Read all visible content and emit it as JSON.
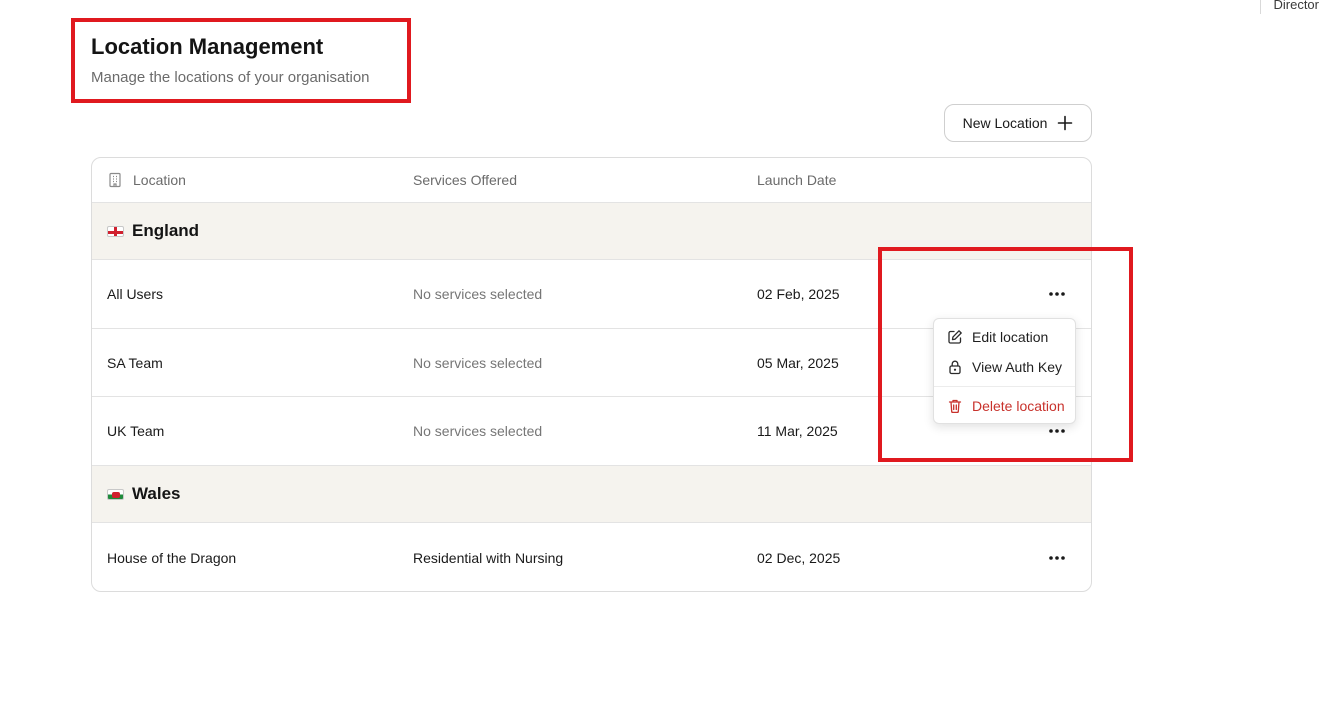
{
  "header": {
    "user_role": "Director",
    "title": "Location Management",
    "subtitle": "Manage the locations of your organisation"
  },
  "toolbar": {
    "new_location_label": "New Location"
  },
  "table": {
    "columns": {
      "location": "Location",
      "services": "Services Offered",
      "launch_date": "Launch Date"
    },
    "groups": [
      {
        "name": "England",
        "flag": "england-flag-icon",
        "rows": [
          {
            "location": "All Users",
            "services": "No services selected",
            "launch_date": "02 Feb, 2025"
          },
          {
            "location": "SA Team",
            "services": "No services selected",
            "launch_date": "05 Mar, 2025"
          },
          {
            "location": "UK Team",
            "services": "No services selected",
            "launch_date": "11 Mar, 2025"
          }
        ]
      },
      {
        "name": "Wales",
        "flag": "wales-flag-icon",
        "rows": [
          {
            "location": "House of the Dragon",
            "services": "Residential with Nursing",
            "launch_date": "02 Dec, 2025"
          }
        ]
      }
    ]
  },
  "row_menu": {
    "items": [
      {
        "label": "Edit location",
        "icon": "edit-icon"
      },
      {
        "label": "View Auth Key",
        "icon": "lock-icon"
      },
      {
        "label": "Delete location",
        "icon": "trash-icon",
        "color": "#c8322c"
      }
    ]
  },
  "colors": {
    "highlight": "#e0191f",
    "group_bg": "#f5f3ee",
    "danger": "#c8322c"
  }
}
